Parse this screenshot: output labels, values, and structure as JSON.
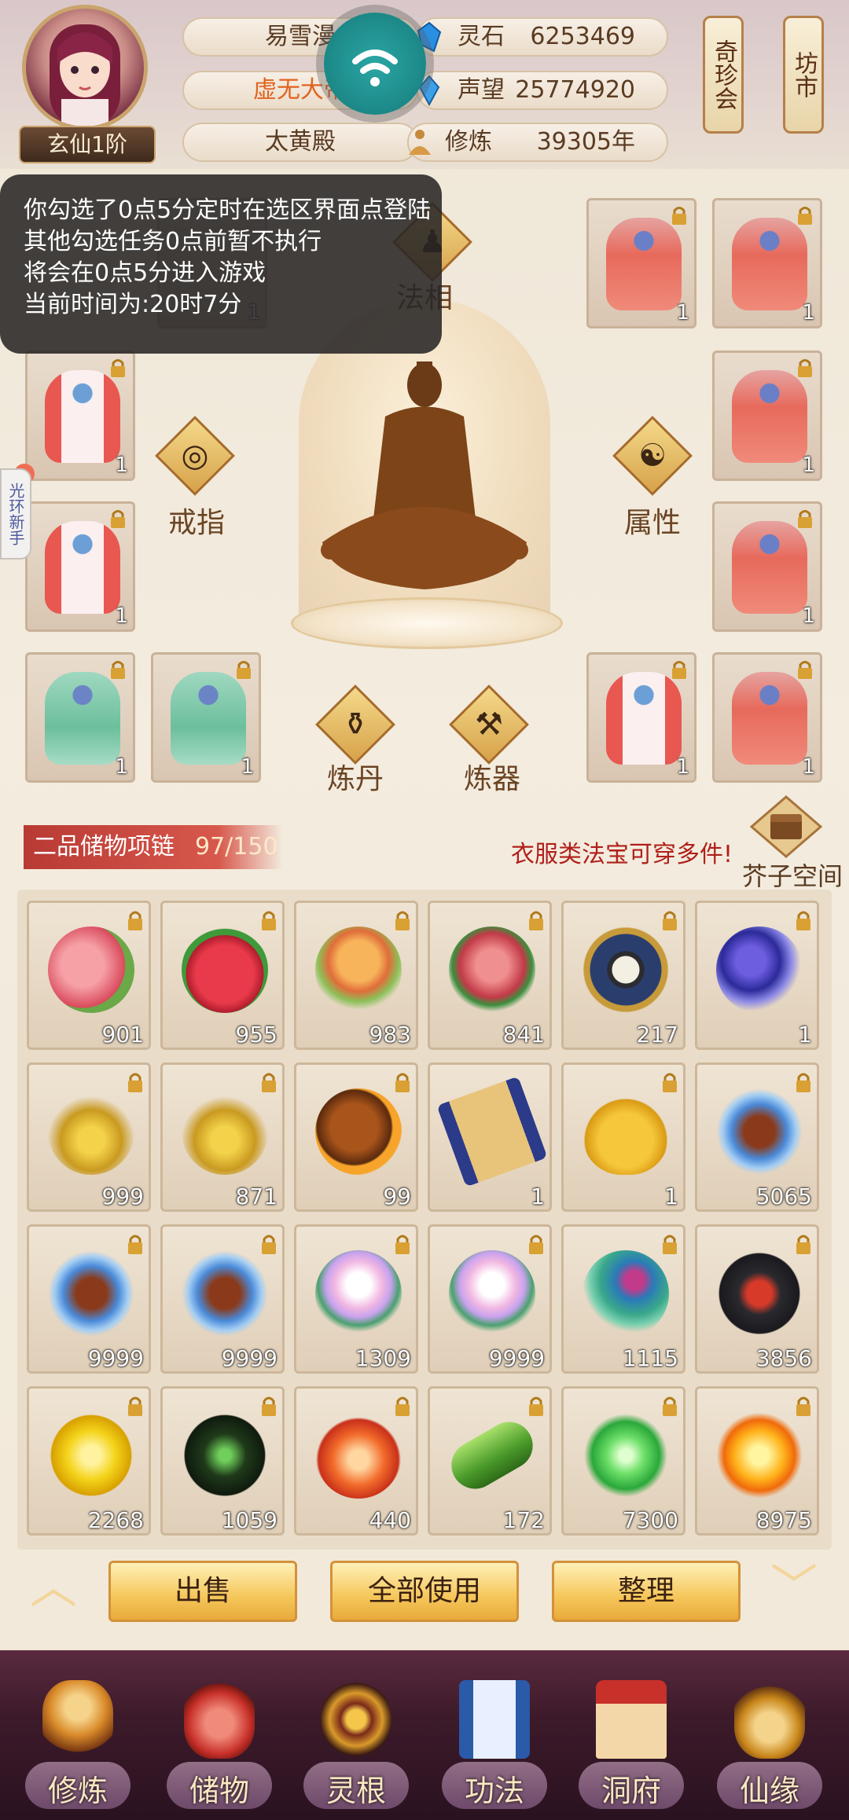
{
  "header": {
    "player_name": "易雪漫",
    "title": "虚无大帝",
    "sect": "太黄殿",
    "rank": "玄仙1阶",
    "resources": [
      {
        "label": "灵石",
        "value": "6253469"
      },
      {
        "label": "声望",
        "value": "25774920"
      },
      {
        "label": "修炼",
        "value": "39305年"
      }
    ],
    "side_buttons": [
      "奇珍会",
      "坊市"
    ]
  },
  "popup": {
    "lines": [
      "你勾选了0点5分定时在选区界面点登陆",
      "其他勾选任务0点前暂不执行",
      "将会在0点5分进入游戏",
      "当前时间为:20时7分"
    ]
  },
  "character": {
    "buttons": {
      "faxiang": "法相",
      "ring": "戒指",
      "attribute": "属性",
      "alchemy": "炼丹",
      "forge": "炼器"
    },
    "slots": [
      {
        "count": "1"
      },
      {
        "count": "1"
      },
      {
        "count": "1"
      },
      {
        "count": "1"
      },
      {
        "count": "1"
      },
      {
        "count": "1"
      },
      {
        "count": "1"
      },
      {
        "count": "1"
      },
      {
        "count": "1"
      },
      {
        "count": "1"
      },
      {
        "count": "1"
      },
      {
        "count": "1"
      }
    ],
    "side_tab": "光环新手"
  },
  "bag": {
    "title": "二品储物项链",
    "capacity": "97/150",
    "note": "衣服类法宝可穿多件!",
    "space_label": "芥子空间",
    "items": [
      {
        "count": "901"
      },
      {
        "count": "955"
      },
      {
        "count": "983"
      },
      {
        "count": "841"
      },
      {
        "count": "217"
      },
      {
        "count": "1"
      },
      {
        "count": "999"
      },
      {
        "count": "871"
      },
      {
        "count": "99"
      },
      {
        "count": "1"
      },
      {
        "count": "1"
      },
      {
        "count": "5065"
      },
      {
        "count": "9999"
      },
      {
        "count": "9999"
      },
      {
        "count": "1309"
      },
      {
        "count": "9999"
      },
      {
        "count": "1115"
      },
      {
        "count": "3856"
      },
      {
        "count": "2268"
      },
      {
        "count": "1059"
      },
      {
        "count": "440"
      },
      {
        "count": "172"
      },
      {
        "count": "7300"
      },
      {
        "count": "8975"
      }
    ]
  },
  "actions": {
    "sell": "出售",
    "use_all": "全部使用",
    "sort": "整理"
  },
  "nav": [
    {
      "label": "修炼"
    },
    {
      "label": "储物"
    },
    {
      "label": "灵根"
    },
    {
      "label": "功法"
    },
    {
      "label": "洞府"
    },
    {
      "label": "仙缘"
    }
  ]
}
